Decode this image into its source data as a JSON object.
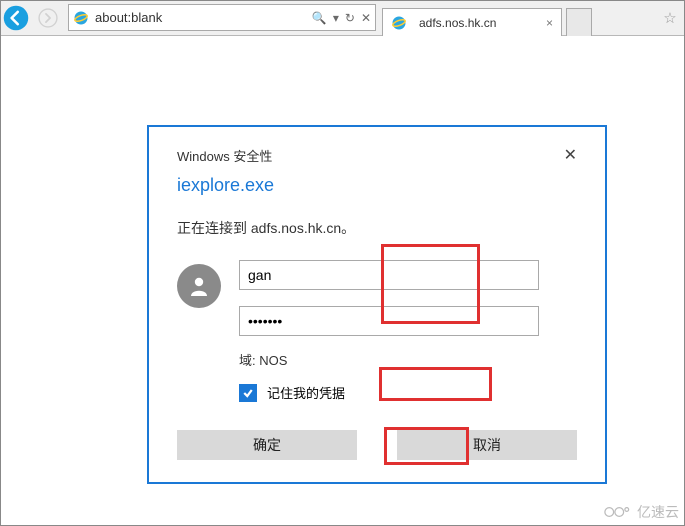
{
  "browser": {
    "address": "about:blank",
    "search_glyph": "🔍",
    "refresh_glyph": "↻",
    "stop_glyph": "✕",
    "tab1_label": "adfs.nos.hk.cn"
  },
  "dialog": {
    "title": "Windows 安全性",
    "subtitle": "iexplore.exe",
    "message": "正在连接到 adfs.nos.hk.cn。",
    "username_value": "gan",
    "password_mask": "•••••••",
    "domain_label": "域: NOS",
    "remember_label": "记住我的凭据",
    "ok_label": "确定",
    "cancel_label": "取消"
  },
  "watermark": "亿速云"
}
